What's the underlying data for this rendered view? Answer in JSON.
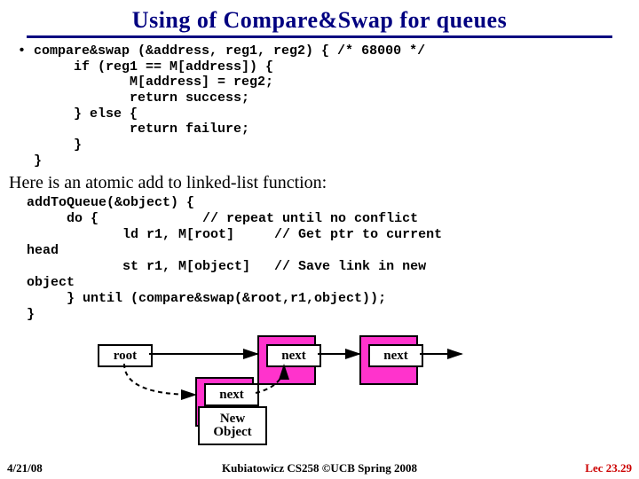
{
  "title": "Using of Compare&Swap for queues",
  "code1": "• compare&swap (&address, reg1, reg2) { /* 68000 */\n       if (reg1 == M[address]) {\n              M[address] = reg2;\n              return success;\n       } else {\n              return failure;\n       }\n  }",
  "subtitle": "Here is an atomic add to linked-list function:",
  "code2": "addToQueue(&object) {\n     do {             // repeat until no conflict\n            ld r1, M[root]     // Get ptr to current\nhead\n            st r1, M[object]   // Save link in new\nobject\n     } until (compare&swap(&root,r1,object));\n}",
  "labels": {
    "root": "root",
    "next1": "next",
    "next2": "next",
    "next3": "next",
    "newobj": "New\nObject"
  },
  "footer": {
    "date": "4/21/08",
    "center": "Kubiatowicz CS258 ©UCB Spring 2008",
    "right": "Lec 23.29"
  }
}
